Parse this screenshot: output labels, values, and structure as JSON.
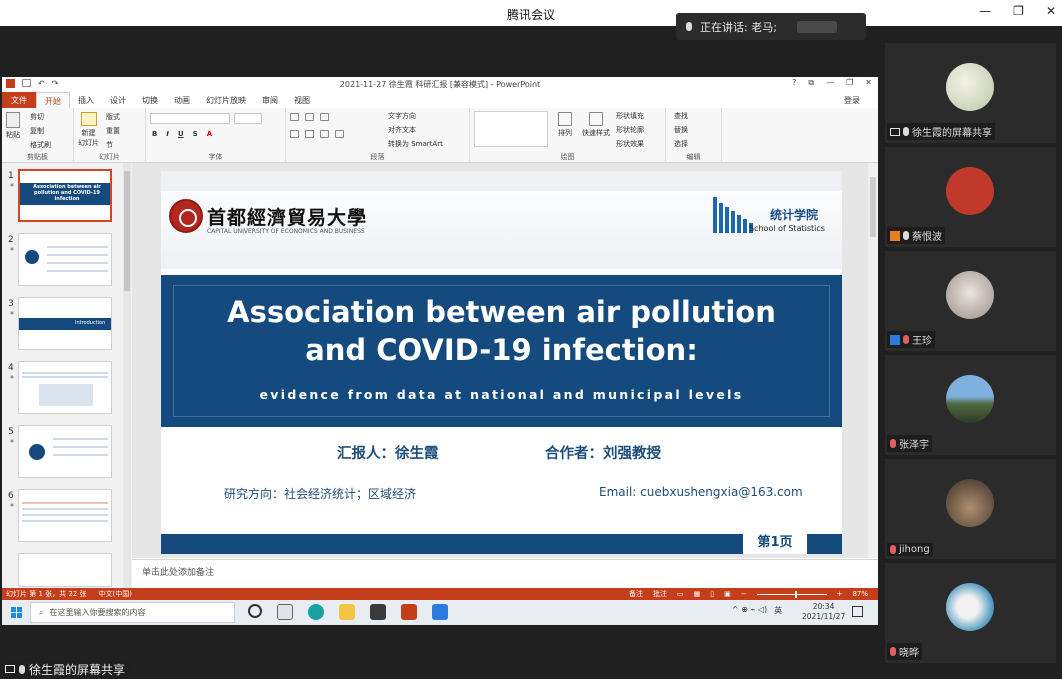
{
  "window": {
    "title": "腾讯会议",
    "controls": [
      "—",
      "❐",
      "✕"
    ]
  },
  "speaking": {
    "text": "正在讲话: 老马;"
  },
  "powerpoint": {
    "title": "2021-11-27 徐生霞 科研汇报 [兼容模式] - PowerPoint",
    "window_controls": [
      "?",
      "⧉",
      "—",
      "❐",
      "✕"
    ],
    "tabs": [
      "文件",
      "开始",
      "插入",
      "设计",
      "切换",
      "动画",
      "幻灯片放映",
      "审阅",
      "视图"
    ],
    "active_tab": "开始",
    "login": "登录",
    "ribbon": {
      "clipboard": {
        "paste": "粘贴",
        "cut": "剪切",
        "copy": "复制",
        "format_painter": "格式刷",
        "label": "剪贴板"
      },
      "slides": {
        "new_slide": "新建\n幻灯片",
        "layout": "版式",
        "reset": "重置",
        "section": "节",
        "label": "幻灯片"
      },
      "font": {
        "label": "字体"
      },
      "paragraph": {
        "text_direction": "文字方向",
        "align_text": "对齐文本",
        "smartart": "转换为 SmartArt",
        "label": "段落"
      },
      "drawing": {
        "arrange": "排列",
        "quick_styles": "快速样式",
        "shape_fill": "形状填充",
        "shape_outline": "形状轮廓",
        "shape_effects": "形状效果",
        "label": "绘图"
      },
      "editing": {
        "find": "查找",
        "replace": "替换",
        "select": "选择",
        "label": "编辑"
      }
    },
    "thumbnails": [
      {
        "num": "1",
        "text": "Association between air pollution and COVID-19 infection"
      },
      {
        "num": "2",
        "text": "Introduction"
      },
      {
        "num": "3",
        "text": "Introduction"
      },
      {
        "num": "4",
        "text": ""
      },
      {
        "num": "5",
        "text": ""
      },
      {
        "num": "6",
        "text": ""
      }
    ],
    "slide": {
      "university_cn": "首都經濟貿易大學",
      "university_en": "CAPITAL UNIVERSITY OF ECONOMICS AND BUSINESS",
      "school_cn": "统计学院",
      "school_en": "School of Statistics",
      "title_line1": "Association between air pollution",
      "title_line2": "and COVID-19 infection:",
      "subtitle": "evidence from data at national and municipal levels",
      "reporter": "汇报人：徐生霞",
      "coauthor": "合作者：刘强教授",
      "research": "研究方向：社会经济统计；区域经济",
      "email": "Email: cuebxushengxia@163.com",
      "page": "第1页"
    },
    "notes_placeholder": "单击此处添加备注",
    "status": {
      "slide_info": "幻灯片 第 1 张，共 22 张",
      "language": "中文(中国)",
      "notes": "备注",
      "comments": "批注",
      "zoom": "87%"
    }
  },
  "taskbar": {
    "search_placeholder": "在这里输入你要搜索的内容",
    "time": "20:34",
    "date": "2021/11/27",
    "tray_lang": "英",
    "tray_symbols": "^  ⊕  ⌁  ◁)"
  },
  "share_label": "徐生霞的屏幕共享",
  "participants": [
    {
      "name": "徐生霞的屏幕共享",
      "avatar_color": "#cfd8c8"
    },
    {
      "name": "蔡恨波",
      "avatar_color": "#c0392b"
    },
    {
      "name": "王珍",
      "avatar_color": "#b9b0aa"
    },
    {
      "name": "张泽宇",
      "avatar_color": "#5b84a8"
    },
    {
      "name": "jihong",
      "avatar_color": "#6a5a4a"
    },
    {
      "name": "晓晔",
      "avatar_color": "#3d8fb8"
    }
  ]
}
